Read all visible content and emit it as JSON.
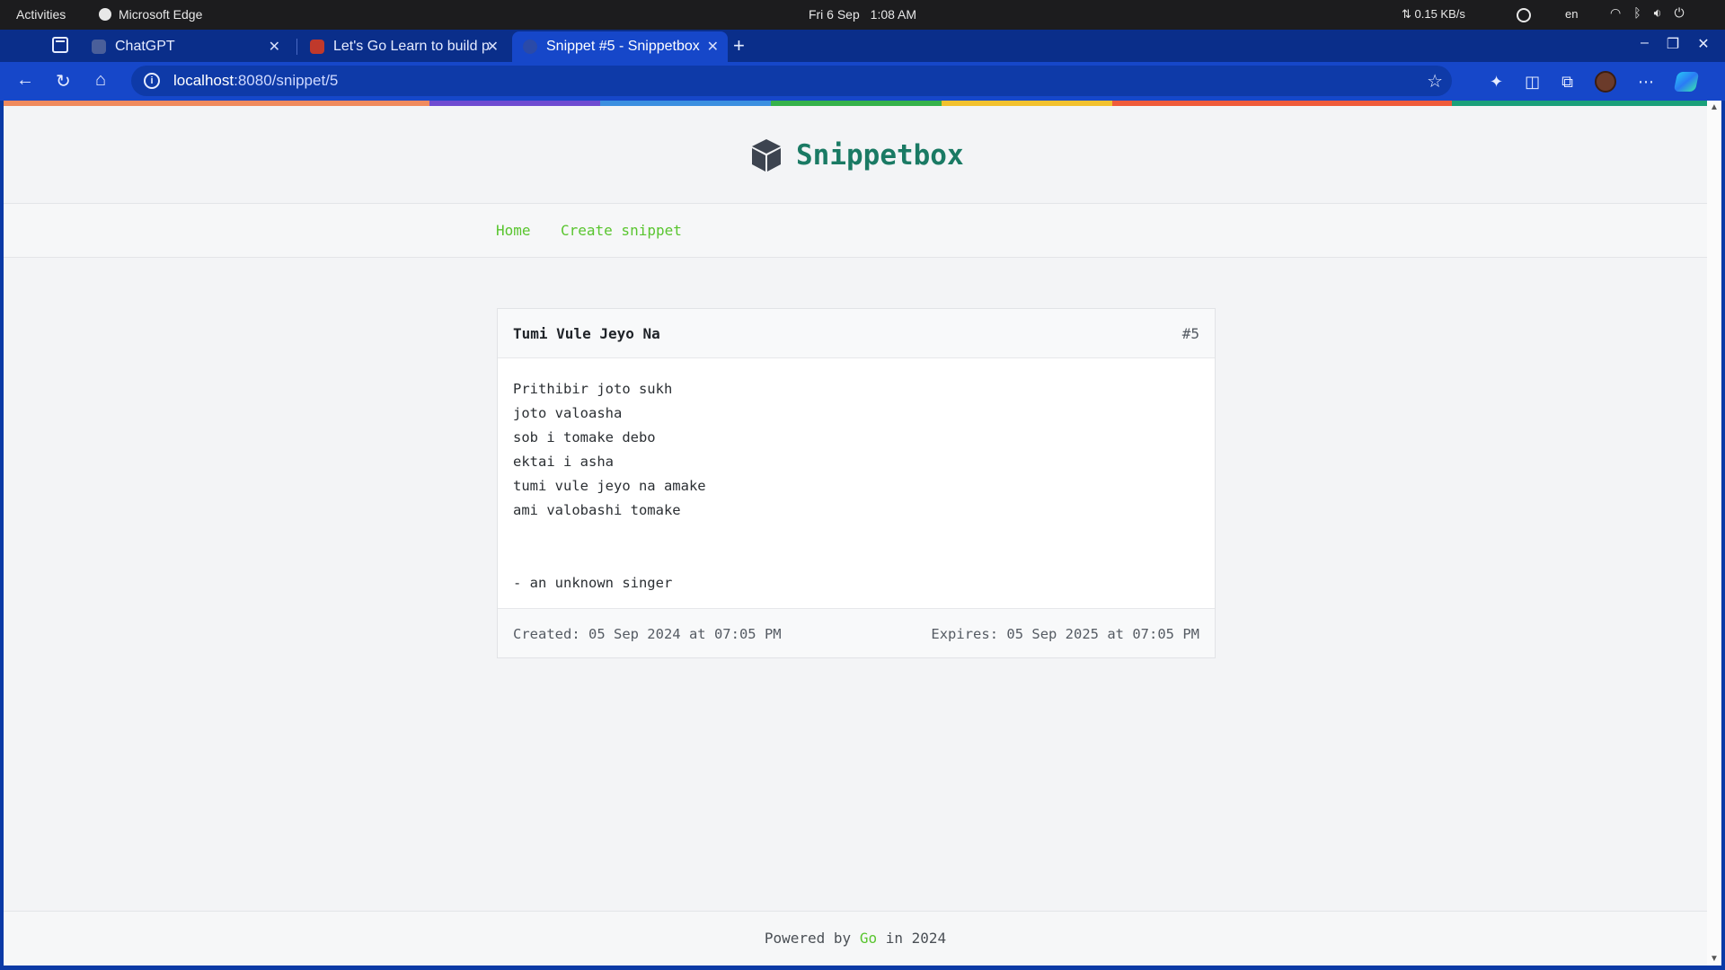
{
  "system_bar": {
    "activities": "Activities",
    "app_name": "Microsoft Edge",
    "date": "Fri 6 Sep",
    "time": "1:08 AM",
    "net_speed": "⇅ 0.15 KB/s",
    "language": "en"
  },
  "browser": {
    "tabs": [
      {
        "title": "ChatGPT",
        "favicon_color": "#4a5f9a",
        "active": false
      },
      {
        "title": "Let's Go Learn to build pr",
        "favicon_color": "#c0392b",
        "active": false
      },
      {
        "title": "Snippet #5 - Snippetbox",
        "favicon_color": "#2a4aa8",
        "active": true
      }
    ],
    "url_host": "localhost",
    "url_rest": ":8080/snippet/5"
  },
  "page": {
    "brand": "Snippetbox",
    "nav": {
      "home": "Home",
      "create": "Create snippet"
    },
    "snippet": {
      "title": "Tumi Vule Jeyo Na",
      "id": "#5",
      "content": "Prithibir joto sukh\njoto valoasha\nsob i tomake debo\nektai i asha\ntumi vule jeyo na amake\nami valobashi tomake\n\n\n- an unknown singer",
      "created": "Created: 05 Sep 2024 at 07:05 PM",
      "expires": "Expires: 05 Sep 2025 at 07:05 PM"
    },
    "footer": {
      "prefix": "Powered by ",
      "link": "Go",
      "suffix": " in 2024"
    },
    "accent_colors": {
      "brand": "#1a7a64",
      "link": "#59c52f"
    }
  }
}
